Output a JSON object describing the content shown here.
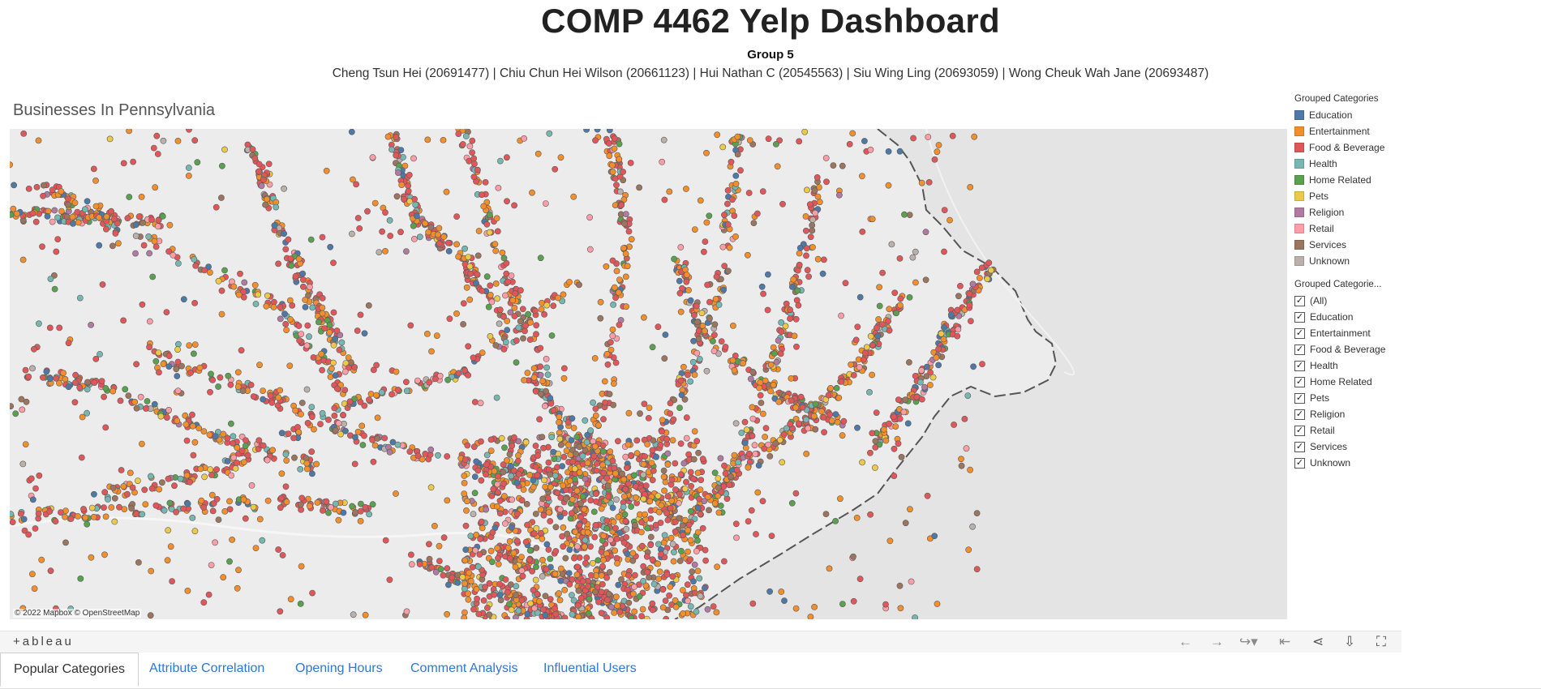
{
  "header": {
    "title": "COMP 4462 Yelp Dashboard",
    "group": "Group 5",
    "members": "Cheng Tsun Hei (20691477) | Chiu Chun Hei Wilson (20661123) | Hui Nathan C (20545563) | Siu Wing Ling (20693059) | Wong Cheuk Wah Jane (20693487)"
  },
  "viz": {
    "title": "Businesses In Pennsylvania",
    "attribution": "© 2022 Mapbox  © OpenStreetMap"
  },
  "color_legend": {
    "title": "Grouped Categories",
    "items": [
      {
        "label": "Education",
        "color": "#4e79a7"
      },
      {
        "label": "Entertainment",
        "color": "#f28e2b"
      },
      {
        "label": "Food & Beverage",
        "color": "#e15759"
      },
      {
        "label": "Health",
        "color": "#76b7b2"
      },
      {
        "label": "Home Related",
        "color": "#59a14f"
      },
      {
        "label": "Pets",
        "color": "#edc948"
      },
      {
        "label": "Religion",
        "color": "#b07aa1"
      },
      {
        "label": "Retail",
        "color": "#ff9da7"
      },
      {
        "label": "Services",
        "color": "#9c755f"
      },
      {
        "label": "Unknown",
        "color": "#bab0ac"
      }
    ]
  },
  "filter": {
    "title": "Grouped Categorie...",
    "items": [
      {
        "label": "(All)",
        "checked": true
      },
      {
        "label": "Education",
        "checked": true
      },
      {
        "label": "Entertainment",
        "checked": true
      },
      {
        "label": "Food & Beverage",
        "checked": true
      },
      {
        "label": "Health",
        "checked": true
      },
      {
        "label": "Home Related",
        "checked": true
      },
      {
        "label": "Pets",
        "checked": true
      },
      {
        "label": "Religion",
        "checked": true
      },
      {
        "label": "Retail",
        "checked": true
      },
      {
        "label": "Services",
        "checked": true
      },
      {
        "label": "Unknown",
        "checked": true
      }
    ]
  },
  "toolbar": {
    "logo": "+ableau",
    "icons": [
      "undo-icon",
      "redo-icon",
      "revert-icon",
      "reset-icon",
      "share-icon",
      "download-icon",
      "fullscreen-icon"
    ]
  },
  "tabs": [
    {
      "label": "Popular Categories",
      "active": true
    },
    {
      "label": "Attribute Correlation",
      "active": false
    },
    {
      "label": "Opening Hours",
      "active": false
    },
    {
      "label": "Comment Analysis",
      "active": false
    },
    {
      "label": "Influential Users",
      "active": false
    }
  ]
}
